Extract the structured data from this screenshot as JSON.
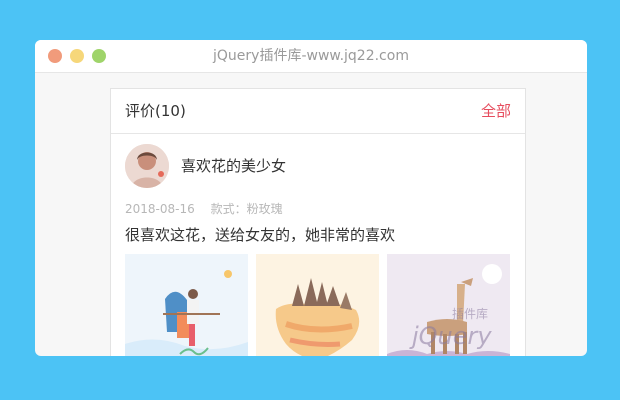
{
  "window": {
    "title": "jQuery插件库-www.jq22.com"
  },
  "reviews_card": {
    "title": "评价(10)",
    "view_all": "全部",
    "review": {
      "username": "喜欢花的美少女",
      "date": "2018-08-16",
      "variant": "款式：粉玫瑰",
      "comment": "很喜欢这花，送给女友的，她非常的喜欢",
      "photo_icons": [
        "couple-illustration",
        "bear-forest-illustration",
        "giraffe-illustration"
      ]
    }
  },
  "watermark": {
    "top": "插件库",
    "bottom": "jQuery"
  },
  "colors": {
    "background": "#4cc3f5",
    "accent": "#e64d5e",
    "muted_text": "#b7b7b7"
  }
}
